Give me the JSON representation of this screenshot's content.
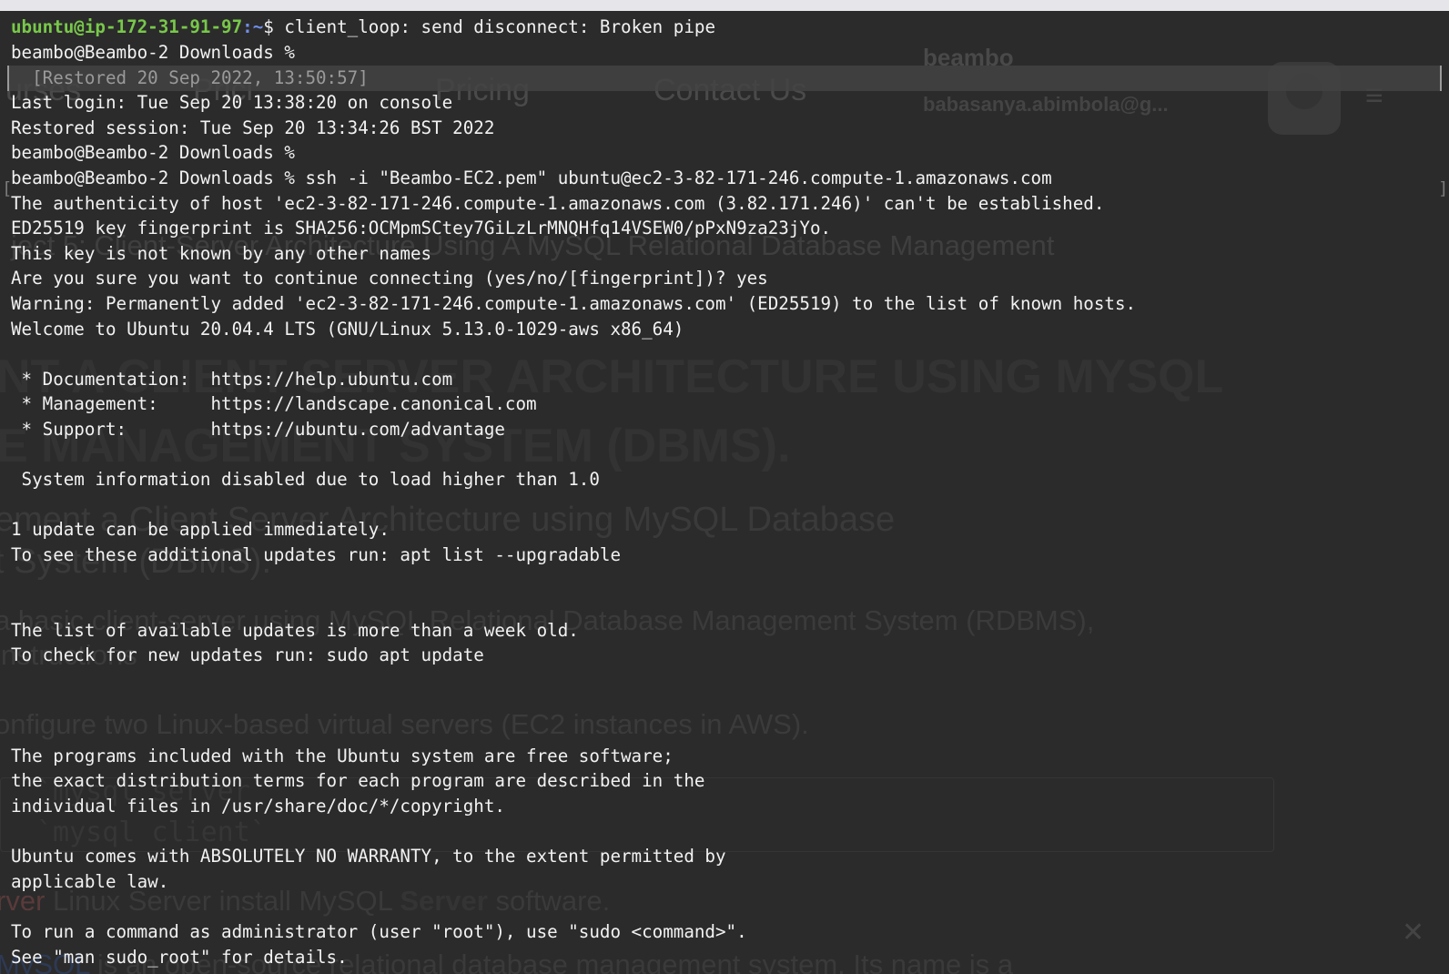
{
  "ghost_page": {
    "nav_items": [
      "urses",
      "Prici",
      "Pricing",
      "Contact Us"
    ],
    "username": "beambo",
    "email": "babasanya.abimbola@g...",
    "menu_glyph": "≡",
    "section_subtitle": "ject 5: Client-Server Architecture Using A MySQL Relational Database Management",
    "heading_line1": "NT A CLIENT SERVER ARCHITECTURE USING MYSQL",
    "heading_line2": "E MANAGEMENT SYSTEM (DBMS).",
    "subheading_line1": "ement a Client Server Architecture using MySQL Database",
    "subheading_line2": "t System (DBMS).",
    "paragraph_line1": "a basic client-server using MySQL Relational Database Management System (RDBMS),",
    "paragraph_line2": "instructions",
    "paragraph_line3": "onfigure two Linux-based virtual servers (EC2 instances in AWS).",
    "code_line1": "`mysql server`",
    "code_line2": "`mysql client`",
    "server_line_red": "rver",
    "server_line_text_a": " Linux Server install MySQL ",
    "server_line_bold": "Server",
    "server_line_text_b": " software.",
    "mysql_line_blue": "MySQL",
    "mysql_line_text": " is an open-source relational database management system. Its name is a",
    "close_glyph": "✕"
  },
  "terminal": {
    "prompt_user_host": "ubuntu@ip-172-31-91-97",
    "prompt_path": ":~",
    "prompt_cmd": "$ client_loop: send disconnect: Broken pipe",
    "restored_banner": "  [Restored 20 Sep 2022, 13:50:57]",
    "lines": [
      "beambo@Beambo-2 Downloads %",
      "",
      "Last login: Tue Sep 20 13:38:20 on console",
      "Restored session: Tue Sep 20 13:34:26 BST 2022",
      "beambo@Beambo-2 Downloads %",
      "beambo@Beambo-2 Downloads % ssh -i \"Beambo-EC2.pem\" ubuntu@ec2-3-82-171-246.compute-1.amazonaws.com",
      "The authenticity of host 'ec2-3-82-171-246.compute-1.amazonaws.com (3.82.171.246)' can't be established.",
      "ED25519 key fingerprint is SHA256:OCMpmSCtey7GiLzLrMNQHfq14VSEW0/pPxN9za23jYo.",
      "This key is not known by any other names",
      "Are you sure you want to continue connecting (yes/no/[fingerprint])? yes",
      "Warning: Permanently added 'ec2-3-82-171-246.compute-1.amazonaws.com' (ED25519) to the list of known hosts.",
      "Welcome to Ubuntu 20.04.4 LTS (GNU/Linux 5.13.0-1029-aws x86_64)",
      "",
      " * Documentation:  https://help.ubuntu.com",
      " * Management:     https://landscape.canonical.com",
      " * Support:        https://ubuntu.com/advantage",
      "",
      " System information disabled due to load higher than 1.0",
      "",
      "1 update can be applied immediately.",
      "To see these additional updates run: apt list --upgradable",
      "",
      "",
      "The list of available updates is more than a week old.",
      "To check for new updates run: sudo apt update",
      "",
      "",
      "",
      "The programs included with the Ubuntu system are free software;",
      "the exact distribution terms for each program are described in the",
      "individual files in /usr/share/doc/*/copyright.",
      "",
      "Ubuntu comes with ABSOLUTELY NO WARRANTY, to the extent permitted by",
      "applicable law.",
      "",
      "To run a command as administrator (user \"root\"), use \"sudo <command>\".",
      "See \"man sudo_root\" for details."
    ]
  },
  "colors": {
    "terminal_bg": "#2b2b2b",
    "terminal_text": "#f2f2f2",
    "prompt_user": "#78c84a",
    "prompt_path": "#6f8fe8"
  }
}
